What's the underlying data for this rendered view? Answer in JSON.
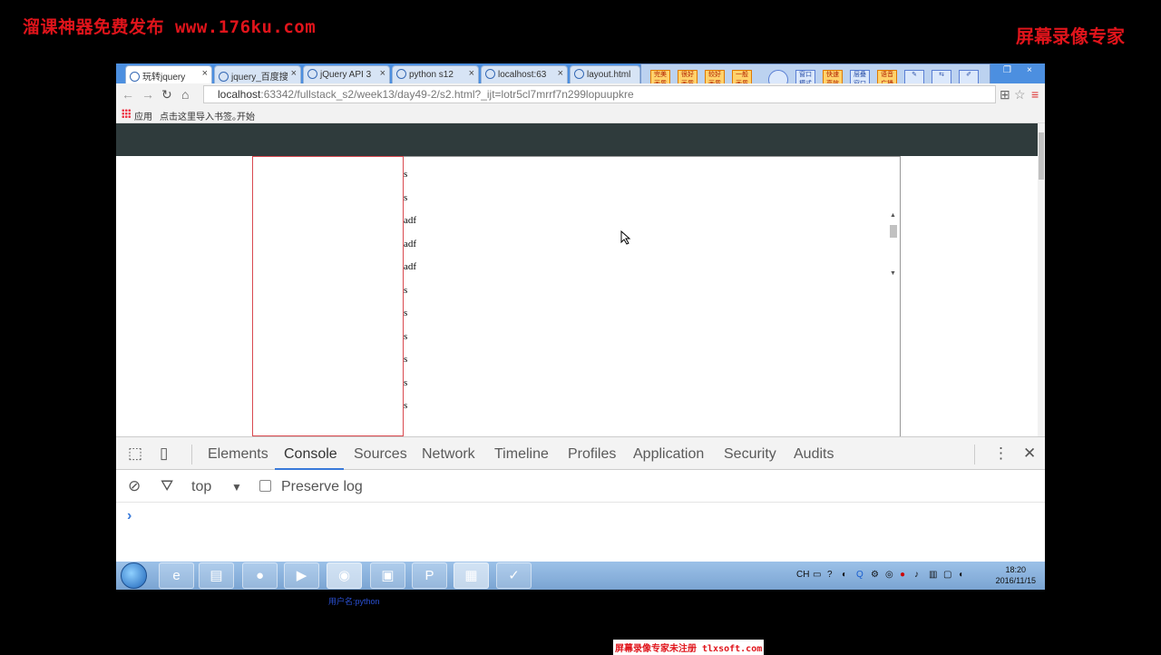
{
  "watermarks": {
    "top_left": "溜课神器免费发布 www.176ku.com",
    "top_right": "屏幕录像专家",
    "bottom": "屏幕录像专家未注册 tlxsoft.com",
    "user": "用户名:python"
  },
  "tabs": [
    {
      "label": "玩转jquery"
    },
    {
      "label": "jquery_百度搜"
    },
    {
      "label": "jQuery API 3"
    },
    {
      "label": "python s12"
    },
    {
      "label": "localhost:63"
    },
    {
      "label": "layout.html"
    }
  ],
  "apptools": [
    "完美画质",
    "很好画质",
    "较好画质",
    "一般画质",
    "",
    "窗口模式",
    "快速高效",
    "层叠窗口",
    "语音广播"
  ],
  "address": {
    "host": "localhost",
    "path": ":63342/fullstack_s2/week13/day49-2/s2.html?_ijt=lotr5cl7mrrf7n299lopuupkre"
  },
  "bookmarks": {
    "apps": "应用",
    "import": "点击这里导入书签。",
    "start": "开始"
  },
  "content_lines": [
    "s",
    "s",
    "adf",
    "adf",
    "adf",
    "s",
    "s",
    "s",
    "s",
    "s",
    "s"
  ],
  "devtools": {
    "tabs": [
      "Elements",
      "Console",
      "Sources",
      "Network",
      "Timeline",
      "Profiles",
      "Application",
      "Security",
      "Audits"
    ],
    "active_tab": "Console",
    "context": "top",
    "preserve_log": "Preserve log",
    "prompt": "›"
  },
  "taskbar": {
    "tray_lang": "CH",
    "time": "18:20",
    "date": "2016/11/15"
  }
}
